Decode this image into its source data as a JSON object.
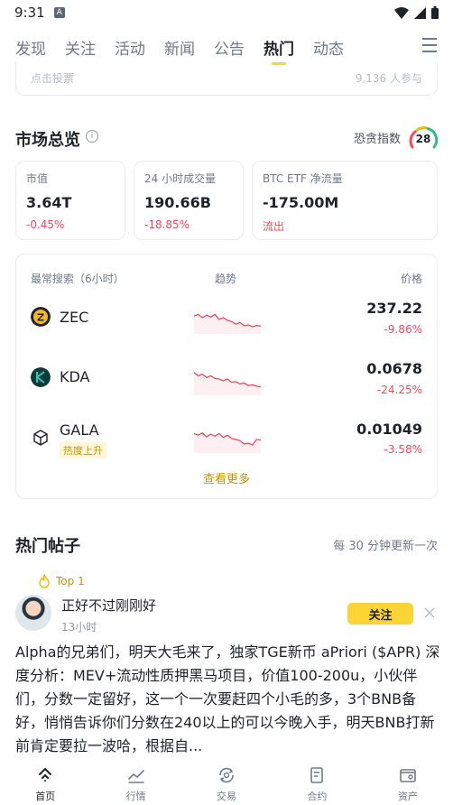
{
  "status_bar": {
    "time": "9:31",
    "notif_letter": "A"
  },
  "tabs": [
    {
      "label": "发现"
    },
    {
      "label": "关注"
    },
    {
      "label": "活动"
    },
    {
      "label": "新闻"
    },
    {
      "label": "公告"
    },
    {
      "label": "热门",
      "active": true
    },
    {
      "label": "动态"
    }
  ],
  "vote_card": {
    "left_text": "点击投票",
    "right_text": "9,136 人参与"
  },
  "market": {
    "title": "市场总览",
    "fear_label": "恐贪指数",
    "fear_value": "28",
    "stats": [
      {
        "label": "市值",
        "value": "3.64T",
        "change": "-0.45%"
      },
      {
        "label": "24 小时成交量",
        "value": "190.66B",
        "change": "-18.85%"
      },
      {
        "label": "BTC ETF 净流量",
        "value": "-175.00M",
        "change": "流出"
      }
    ]
  },
  "search": {
    "col_name": "最常搜索（6小时）",
    "col_trend": "趋势",
    "col_price": "价格",
    "coins": [
      {
        "symbol": "ZEC",
        "price": "237.22",
        "change": "-9.86%",
        "icon": "zec-icon",
        "spark": [
          0.55,
          0.6,
          0.5,
          0.58,
          0.52,
          0.6,
          0.45,
          0.5,
          0.42,
          0.38,
          0.3,
          0.35,
          0.25,
          0.28,
          0.22,
          0.26,
          0.24
        ]
      },
      {
        "symbol": "KDA",
        "price": "0.0678",
        "change": "-24.25%",
        "icon": "kda-icon",
        "spark": [
          0.7,
          0.6,
          0.65,
          0.55,
          0.6,
          0.52,
          0.5,
          0.45,
          0.5,
          0.4,
          0.42,
          0.35,
          0.38,
          0.3,
          0.32,
          0.28,
          0.26
        ]
      },
      {
        "symbol": "GALA",
        "price": "0.01049",
        "change": "-3.58%",
        "icon": "gala-icon",
        "badge": "热度上升",
        "spark": [
          0.6,
          0.55,
          0.62,
          0.5,
          0.58,
          0.52,
          0.6,
          0.48,
          0.55,
          0.45,
          0.42,
          0.38,
          0.28,
          0.3,
          0.25,
          0.42,
          0.4
        ]
      }
    ],
    "see_more": "查看更多"
  },
  "posts": {
    "title": "热门帖子",
    "update_note": "每 30 分钟更新一次",
    "top": {
      "rank": "Top 1",
      "author": "正好不过刚刚好",
      "time": "13小时",
      "follow_label": "关注",
      "text": "Alpha的兄弟们，明天大毛来了，独家TGE新币 aPriori ($APR) 深度分析：MEV+流动性质押黑马项目，价值100-200u，小伙伴们，分数一定留好，这一个一次要赶四个小毛的多，3个BNB备好，悄悄告诉你们分数在240以上的可以今晚入手，明天BNB打新前肯定要拉一波哈，根据自..."
    }
  },
  "bottom_nav": [
    {
      "label": "首页",
      "icon": "home-icon",
      "active": true
    },
    {
      "label": "行情",
      "icon": "markets-icon"
    },
    {
      "label": "交易",
      "icon": "trade-icon"
    },
    {
      "label": "合约",
      "icon": "futures-icon"
    },
    {
      "label": "资产",
      "icon": "wallet-icon"
    }
  ],
  "colors": {
    "accent": "#fcd535",
    "down": "#f6465d",
    "gold_text": "#c99400"
  }
}
